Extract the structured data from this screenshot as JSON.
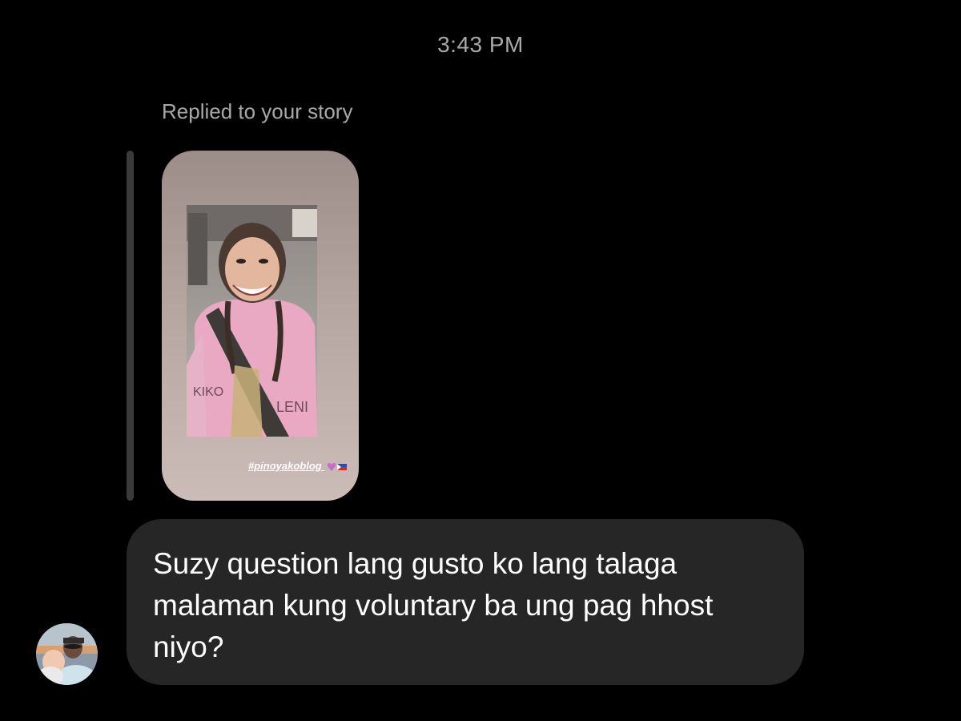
{
  "thread": {
    "timestamp": "3:43 PM",
    "reply_label": "Replied to your story"
  },
  "story": {
    "hashtag": "#pinoyakoblog",
    "shirt_text_left": "KIKO",
    "shirt_text_right": "LENI",
    "colors": {
      "card_background": "#b3a4a0",
      "shirt": "#e9a9c3"
    }
  },
  "message": {
    "text": "Suzy question lang gusto ko lang talaga malaman kung voluntary ba ung pag hhost niyo?",
    "bubble_color": "#262626"
  },
  "sender": {
    "avatar_icon": "profile-photo-icon"
  }
}
